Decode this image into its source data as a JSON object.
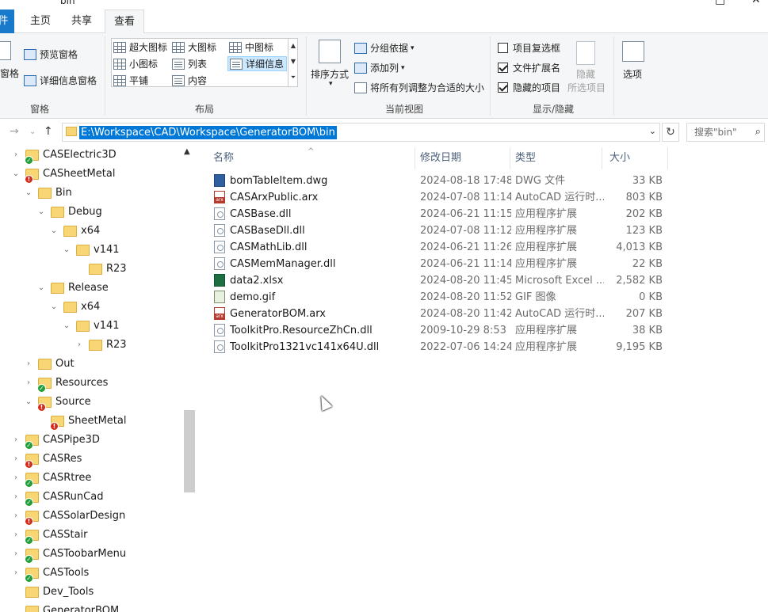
{
  "window": {
    "title": "bin",
    "controls": [
      "□",
      "✕"
    ]
  },
  "ribbon_tabs": [
    {
      "label": "件"
    },
    {
      "label": "主页"
    },
    {
      "label": "共享"
    },
    {
      "label": "查看"
    }
  ],
  "ribbon": {
    "pane_group": {
      "nav_pane_label": "窗格",
      "preview_label": "预览窗格",
      "details_label": "详细信息窗格",
      "group_label": "窗格"
    },
    "layout_group": {
      "items": [
        "超大图标",
        "大图标",
        "中图标",
        "小图标",
        "列表",
        "详细信息",
        "平铺",
        "内容"
      ],
      "selected": "详细信息",
      "group_label": "布局"
    },
    "current_view_group": {
      "sort_label": "排序方式",
      "group_by_label": "分组依据",
      "add_columns_label": "添加列",
      "fit_columns_label": "将所有列调整为合适的大小",
      "group_label": "当前视图"
    },
    "show_hide_group": {
      "item_checkboxes": {
        "label": "项目复选框",
        "checked": false
      },
      "file_extensions": {
        "label": "文件扩展名",
        "checked": true
      },
      "hidden_items": {
        "label": "隐藏的项目",
        "checked": true
      },
      "hide_selected_label_1": "隐藏",
      "hide_selected_label_2": "所选项目",
      "group_label": "显示/隐藏"
    },
    "options_label": "选项"
  },
  "address_bar": {
    "path": "E:\\Workspace\\CAD\\Workspace\\GeneratorBOM\\bin",
    "search_placeholder": "搜索\"bin\""
  },
  "nav_tree": [
    {
      "label": "CASElectric3D",
      "level": 1,
      "badge": "ok",
      "arrow": "›"
    },
    {
      "label": "CASheetMetal",
      "level": 1,
      "badge": "warn",
      "arrow": "⌄"
    },
    {
      "label": "Bin",
      "level": 2,
      "badge": "",
      "arrow": "⌄"
    },
    {
      "label": "Debug",
      "level": 3,
      "badge": "",
      "arrow": "⌄"
    },
    {
      "label": "x64",
      "level": 4,
      "badge": "",
      "arrow": "⌄"
    },
    {
      "label": "v141",
      "level": 5,
      "badge": "",
      "arrow": "⌄"
    },
    {
      "label": "R23",
      "level": 6,
      "badge": "",
      "arrow": ""
    },
    {
      "label": "Release",
      "level": 3,
      "badge": "",
      "arrow": "⌄"
    },
    {
      "label": "x64",
      "level": 4,
      "badge": "",
      "arrow": "⌄"
    },
    {
      "label": "v141",
      "level": 5,
      "badge": "",
      "arrow": "⌄"
    },
    {
      "label": "R23",
      "level": 6,
      "badge": "",
      "arrow": "›"
    },
    {
      "label": "Out",
      "level": 2,
      "badge": "",
      "arrow": "›"
    },
    {
      "label": "Resources",
      "level": 2,
      "badge": "ok",
      "arrow": "›"
    },
    {
      "label": "Source",
      "level": 2,
      "badge": "warn",
      "arrow": "⌄"
    },
    {
      "label": "SheetMetal",
      "level": 3,
      "badge": "warn",
      "arrow": ""
    },
    {
      "label": "CASPipe3D",
      "level": 1,
      "badge": "ok",
      "arrow": "›"
    },
    {
      "label": "CASRes",
      "level": 1,
      "badge": "warn",
      "arrow": "›"
    },
    {
      "label": "CASRtree",
      "level": 1,
      "badge": "ok",
      "arrow": "›"
    },
    {
      "label": "CASRunCad",
      "level": 1,
      "badge": "ok",
      "arrow": "›"
    },
    {
      "label": "CASSolarDesign",
      "level": 1,
      "badge": "warn",
      "arrow": "›"
    },
    {
      "label": "CASStair",
      "level": 1,
      "badge": "ok",
      "arrow": "›"
    },
    {
      "label": "CASToobarMenu",
      "level": 1,
      "badge": "ok",
      "arrow": "›"
    },
    {
      "label": "CASTools",
      "level": 1,
      "badge": "ok",
      "arrow": "›"
    },
    {
      "label": "Dev_Tools",
      "level": 1,
      "badge": "",
      "arrow": ""
    },
    {
      "label": "GeneratorBOM",
      "level": 1,
      "badge": "ok",
      "arrow": ""
    }
  ],
  "columns": [
    {
      "label": "名称"
    },
    {
      "label": "修改日期"
    },
    {
      "label": "类型"
    },
    {
      "label": "大小"
    }
  ],
  "files": [
    {
      "name": "bomTableItem.dwg",
      "date": "2024-08-18 17:48",
      "type": "DWG 文件",
      "size": "33 KB",
      "icon": "dwg"
    },
    {
      "name": "CASArxPublic.arx",
      "date": "2024-07-08 11:14",
      "type": "AutoCAD 运行时...",
      "size": "803 KB",
      "icon": "arx"
    },
    {
      "name": "CASBase.dll",
      "date": "2024-06-21 11:15",
      "type": "应用程序扩展",
      "size": "202 KB",
      "icon": "dll"
    },
    {
      "name": "CASBaseDll.dll",
      "date": "2024-07-08 11:12",
      "type": "应用程序扩展",
      "size": "123 KB",
      "icon": "dll"
    },
    {
      "name": "CASMathLib.dll",
      "date": "2024-06-21 11:26",
      "type": "应用程序扩展",
      "size": "4,013 KB",
      "icon": "dll"
    },
    {
      "name": "CASMemManager.dll",
      "date": "2024-06-21 11:14",
      "type": "应用程序扩展",
      "size": "22 KB",
      "icon": "dll"
    },
    {
      "name": "data2.xlsx",
      "date": "2024-08-20 11:45",
      "type": "Microsoft Excel ...",
      "size": "2,582 KB",
      "icon": "xlsx"
    },
    {
      "name": "demo.gif",
      "date": "2024-08-20 11:52",
      "type": "GIF 图像",
      "size": "0 KB",
      "icon": "gif"
    },
    {
      "name": "GeneratorBOM.arx",
      "date": "2024-08-20 11:42",
      "type": "AutoCAD 运行时...",
      "size": "207 KB",
      "icon": "arx"
    },
    {
      "name": "ToolkitPro.ResourceZhCn.dll",
      "date": "2009-10-29 8:53",
      "type": "应用程序扩展",
      "size": "38 KB",
      "icon": "dll"
    },
    {
      "name": "ToolkitPro1321vc141x64U.dll",
      "date": "2022-07-06 14:24",
      "type": "应用程序扩展",
      "size": "9,195 KB",
      "icon": "dll"
    }
  ],
  "colors": {
    "accent": "#0078d7",
    "file_tab": "#1979ca",
    "selection_bg": "#cce8ff",
    "badge_ok": "#1e9e3a",
    "badge_warn": "#d42a1e",
    "folder": "#f8d675"
  }
}
